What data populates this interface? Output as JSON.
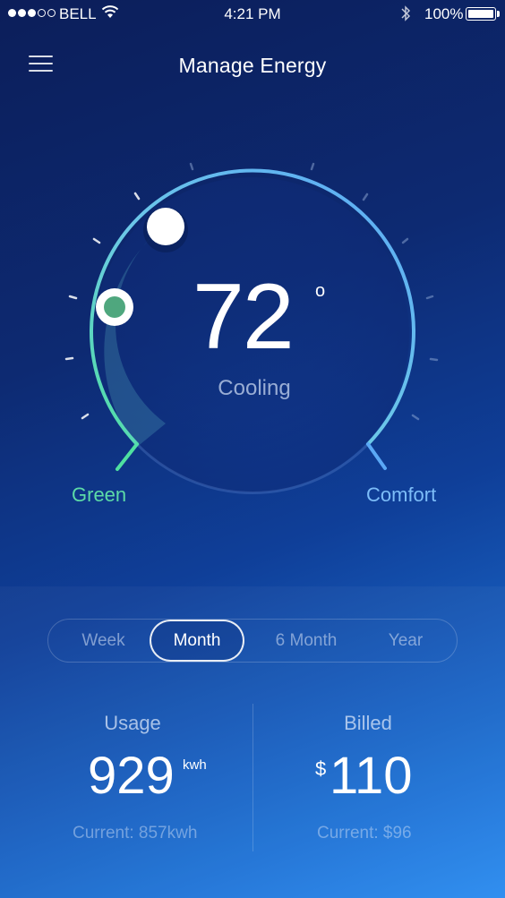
{
  "status_bar": {
    "carrier": "BELL",
    "time": "4:21 PM",
    "battery": "100%",
    "signal_icon": "signal-dots-icon",
    "wifi_icon": "wifi-icon",
    "bluetooth_icon": "bluetooth-icon",
    "battery_icon": "battery-icon"
  },
  "header": {
    "title": "Manage Energy",
    "menu_icon": "hamburger-menu-icon"
  },
  "thermostat": {
    "temperature": "72",
    "degree_symbol": "o",
    "mode": "Cooling",
    "left_label": "Green",
    "right_label": "Comfort"
  },
  "tabs": [
    {
      "label": "Week",
      "active": false
    },
    {
      "label": "Month",
      "active": true
    },
    {
      "label": "6 Month",
      "active": false
    },
    {
      "label": "Year",
      "active": false
    }
  ],
  "usage": {
    "label": "Usage",
    "value": "929",
    "unit": "kwh",
    "current": "Current: 857kwh"
  },
  "billed": {
    "label": "Billed",
    "currency": "$",
    "value": "110",
    "current": "Current: $96"
  },
  "colors": {
    "green_accent": "#5ddba7",
    "comfort_accent": "#7dbdf8",
    "bg_top": "#0c1e5a",
    "bg_bottom": "#2a8bf0"
  }
}
